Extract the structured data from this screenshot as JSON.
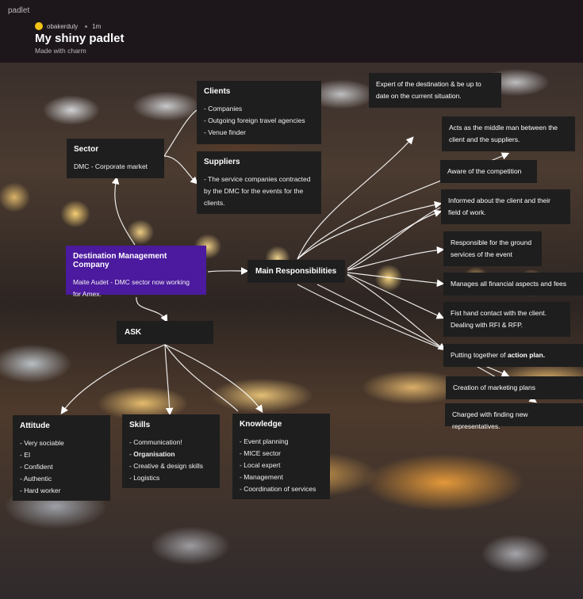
{
  "header": {
    "brand": "padlet",
    "author": "obakerduly",
    "time": "1m",
    "title": "My shiny padlet",
    "subtitle": "Made with charm",
    "avatar_color": "#f3c316"
  },
  "cards": {
    "clients": {
      "title": "Clients",
      "lines": [
        "- Companies",
        "- Outgoing foreign travel agencies",
        "- Venue finder"
      ]
    },
    "sector": {
      "title": "Sector",
      "lines": [
        "DMC - Corporate market"
      ]
    },
    "suppliers": {
      "title": "Suppliers",
      "lines": [
        "- The service companies contracted",
        "by the DMC for the events for the",
        "clients."
      ]
    },
    "dmc": {
      "title": "Destination Management Company",
      "lines": [
        "Maite Audet - DMC sector now working",
        "for Amex."
      ],
      "color": "#4b1a9e"
    },
    "main_responsibilities": {
      "title": "Main Responsibilities"
    },
    "ask": {
      "title": "ASK"
    },
    "attitude": {
      "title": "Attitude",
      "lines": [
        "- Very sociable",
        "- EI",
        "- Confident",
        "- Authentic",
        "- Hard worker"
      ]
    },
    "skills": {
      "title": "Skills",
      "line1": "- Communication!",
      "line2_prefix": "- ",
      "line2_bold": "Organisation",
      "line3": "- Creative & design skills",
      "line4": "- Logistics"
    },
    "knowledge": {
      "title": "Knowledge",
      "lines": [
        "- Event planning",
        "- MICE sector",
        "- Local expert",
        "- Management",
        "- Coordination of services"
      ]
    },
    "expert": {
      "lines": [
        "Expert of the destination & be up to",
        "date on the current situation."
      ]
    },
    "middle_man": {
      "lines": [
        "Acts as the middle man between the",
        "client and the suppliers."
      ]
    },
    "competition": {
      "text": "Aware of the competition"
    },
    "informed": {
      "lines": [
        "Informed about the client and their",
        "field of work."
      ]
    },
    "ground": {
      "lines": [
        "Responsible for the ground",
        "services of the event"
      ]
    },
    "financial": {
      "text": "Manages all financial aspects and fees"
    },
    "contact": {
      "lines": [
        "Fist hand contact with the client.",
        "Dealing with RFI & RFP."
      ]
    },
    "action_plan": {
      "prefix": "Putting together of ",
      "bold": "action plan."
    },
    "marketing": {
      "text": "Creation of marketing plans"
    },
    "representatives": {
      "text": "Charged with finding new representatives."
    }
  }
}
